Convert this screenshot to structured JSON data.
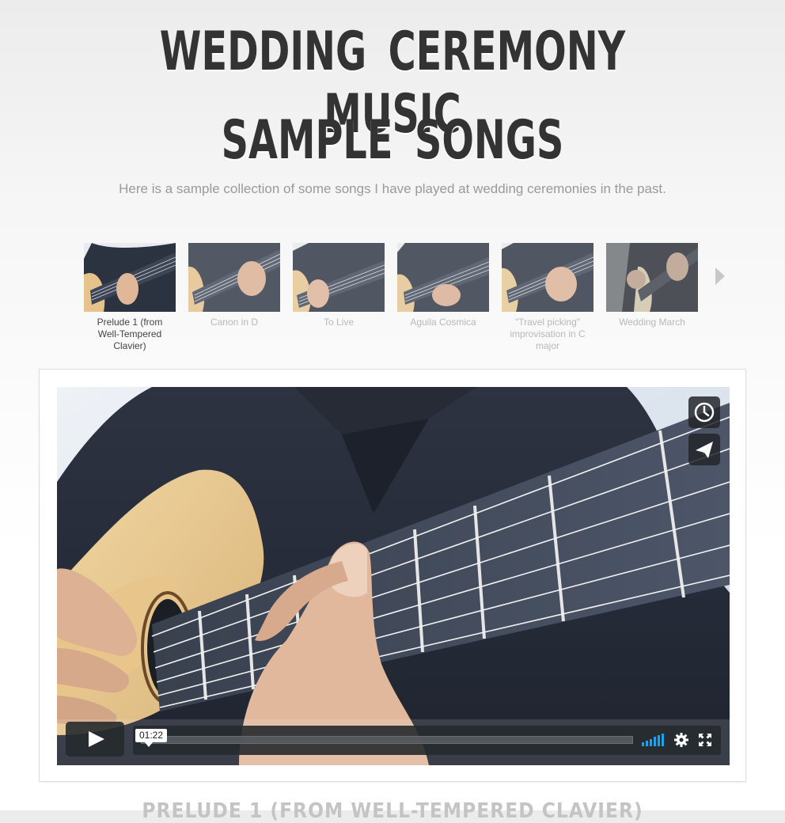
{
  "header": {
    "title_line1": "WEDDING CEREMONY MUSIC",
    "title_line2": "SAMPLE SONGS",
    "subtitle": "Here is a sample collection of some songs I have played at wedding ceremonies in the past."
  },
  "playlist": {
    "items": [
      {
        "label": "Prelude 1 (from Well-Tempered Clavier)",
        "active": true
      },
      {
        "label": "Canon in D",
        "active": false
      },
      {
        "label": "To Live",
        "active": false
      },
      {
        "label": "Aguila Cosmica",
        "active": false
      },
      {
        "label": "\"Travel picking\" improvisation in C major",
        "active": false
      },
      {
        "label": "Wedding March",
        "active": false
      }
    ],
    "next_icon": "chevron-right-icon"
  },
  "player": {
    "current_time": "01:22",
    "progress_fraction": 0.0,
    "volume_fraction": 1.0,
    "icons": {
      "watch_later": "clock-icon",
      "share": "paper-plane-icon",
      "play": "play-icon",
      "volume": "volume-icon",
      "settings": "gear-icon",
      "fullscreen": "fullscreen-icon"
    },
    "accent_color": "#1aa3e8"
  },
  "now_playing": {
    "title": "PRELUDE 1 (FROM WELL-TEMPERED CLAVIER)"
  }
}
